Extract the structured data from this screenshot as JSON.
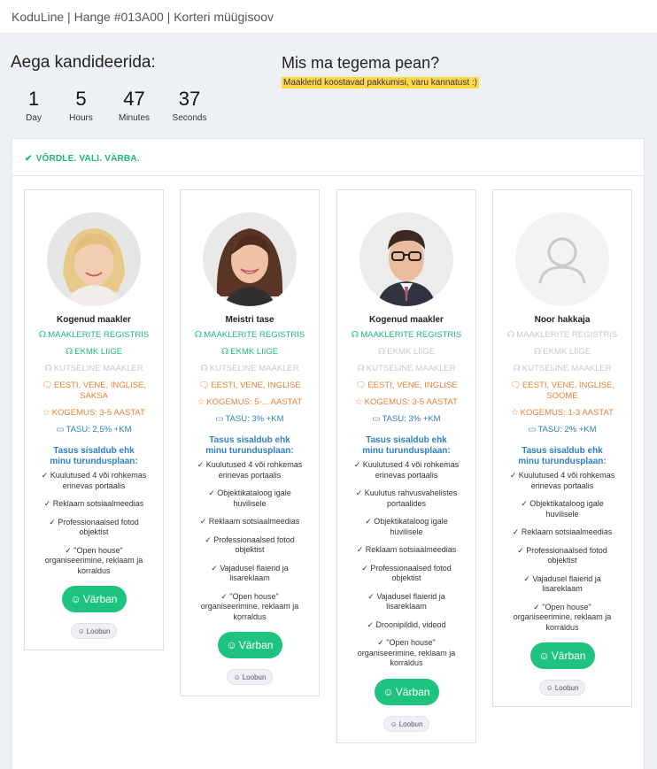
{
  "window": {
    "title": "KoduLine | Hange #013A00 | Korteri müügisoov"
  },
  "countdown": {
    "title": "Aega kandideerida:",
    "units": [
      {
        "value": "1",
        "label": "Day"
      },
      {
        "value": "5",
        "label": "Hours"
      },
      {
        "value": "47",
        "label": "Minutes"
      },
      {
        "value": "37",
        "label": "Seconds"
      }
    ]
  },
  "task": {
    "title": "Mis ma tegema pean?",
    "note": "Maaklerid koostavad pakkumisi, varu kannatust :)"
  },
  "panel": {
    "header": "VÕRDLE. VALI. VÄRBA."
  },
  "colors": {
    "accent": "#1dc37e",
    "orange": "#e8813a",
    "blue": "#2f80c5",
    "highlight": "#ffd84a"
  },
  "cards": [
    {
      "title": "Kogenud maakler",
      "avatar": "photo-blonde-woman",
      "registry": "MAAKLERITE REGISTRIS",
      "ekmk": "EKMK LIIGE",
      "professional": "KUTSELINE MAAKLER",
      "languages": "EESTI, VENE, INGLISE, SAKSA",
      "experience": "KOGEMUS: 3-5 AASTAT",
      "fee": "TASU: 2,5% +KM",
      "plan_title": "Tasus sisaldub ehk minu turundusplaan:",
      "plan_items": [
        "✓ Kuulutused 4 või rohkemas erinevas portaalis",
        "✓ Reklaam sotsiaalmeedias",
        "✓ Professionaalsed fotod objektist",
        "✓ \"Open house\" organiseerimine, reklaam ja korraldus"
      ],
      "recruit": "Värban",
      "decline": "Loobun"
    },
    {
      "title": "Meistri tase",
      "avatar": "photo-brunette-woman",
      "registry": "MAAKLERITE REGISTRIS",
      "ekmk": "EKMK LIIGE",
      "professional": "KUTSELINE MAAKLER",
      "languages": "EESTI, VENE, INGLISE",
      "experience": "KOGEMUS: 5-... AASTAT",
      "fee": "TASU: 3% +KM",
      "plan_title": "Tasus sisaldub ehk minu turundusplaan:",
      "plan_items": [
        "✓ Kuulutused 4 või rohkemas erinevas portaalis",
        "✓ Objektikataloog igale huvilisele",
        "✓ Reklaam sotsiaalmeedias",
        "✓ Professionaalsed fotod objektist",
        "✓ Vajadusel flaierid ja lisareklaam",
        "✓ \"Open house\" organiseerimine, reklaam ja korraldus"
      ],
      "recruit": "Värban",
      "decline": "Loobun"
    },
    {
      "title": "Kogenud maakler",
      "avatar": "photo-man-glasses",
      "registry": "MAAKLERITE REGISTRIS",
      "ekmk": "EKMK LIIGE",
      "professional": "KUTSELINE MAAKLER",
      "languages": "EESTI, VENE, INGLISE",
      "experience": "KOGEMUS: 3-5 AASTAT",
      "fee": "TASU: 3% +KM",
      "plan_title": "Tasus sisaldub ehk minu turundusplaan:",
      "plan_items": [
        "✓ Kuulutused 4 või rohkemas erinevas portaalis",
        "✓ Kuulutus rahvusvahelistes portaalides",
        "✓ Objektikataloog igale huvilisele",
        "✓ Reklaam sotsiaalmeedias",
        "✓ Professionaalsed fotod objektist",
        "✓ Vajadusel flaierid ja lisareklaam",
        "✓ Droonipildid, videod",
        "✓ \"Open house\" organiseerimine, reklaam ja korraldus"
      ],
      "recruit": "Värban",
      "decline": "Loobun"
    },
    {
      "title": "Noor hakkaja",
      "avatar": "user-placeholder-icon",
      "registry": "MAAKLERITE REGISTRIS",
      "ekmk": "EKMK LIIGE",
      "professional": "KUTSELINE MAAKLER",
      "languages": "EESTI, VENE, INGLISE, SOOME",
      "experience": "KOGEMUS: 1-3 AASTAT",
      "fee": "TASU: 2% +KM",
      "plan_title": "Tasus sisaldub ehk minu turundusplaan:",
      "plan_items": [
        "✓ Kuulutused 4 või rohkemas erinevas portaalis",
        "✓ Objektikataloog igale huvilisele",
        "✓ Reklaam sotsiaalmeedias",
        "✓ Professionaalsed fotod objektist",
        "✓ Vajadusel flaierid ja lisareklaam",
        "✓ \"Open house\" organiseerimine, reklaam ja korraldus"
      ],
      "recruit": "Värban",
      "decline": "Loobun"
    }
  ]
}
